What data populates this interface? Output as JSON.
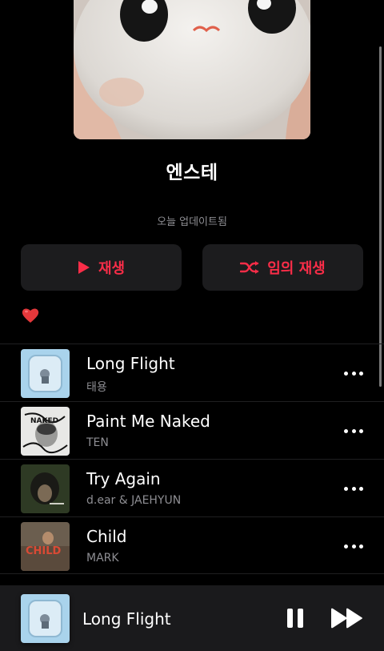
{
  "playlist": {
    "title": "엔스테",
    "updated": "오늘 업데이트됨",
    "play_label": "재생",
    "shuffle_label": "임의 재생",
    "emoji": "❤️"
  },
  "tracks": [
    {
      "title": "Long Flight",
      "artist": "태용"
    },
    {
      "title": "Paint Me Naked",
      "artist": "TEN"
    },
    {
      "title": "Try Again",
      "artist": "d.ear & JAEHYUN"
    },
    {
      "title": "Child",
      "artist": "MARK"
    }
  ],
  "art_text": {
    "paint_me_naked": "NAKED",
    "child": "CHILD"
  },
  "now_playing": {
    "title": "Long Flight"
  },
  "colors": {
    "accent": "#fa2d48",
    "background": "#000000",
    "button_bg": "#1c1c1e",
    "secondary_text": "#8e8e93"
  },
  "icons": {
    "play": "play-icon",
    "shuffle": "shuffle-icon",
    "more": "more-icon",
    "pause": "pause-icon",
    "next": "next-track-icon"
  }
}
